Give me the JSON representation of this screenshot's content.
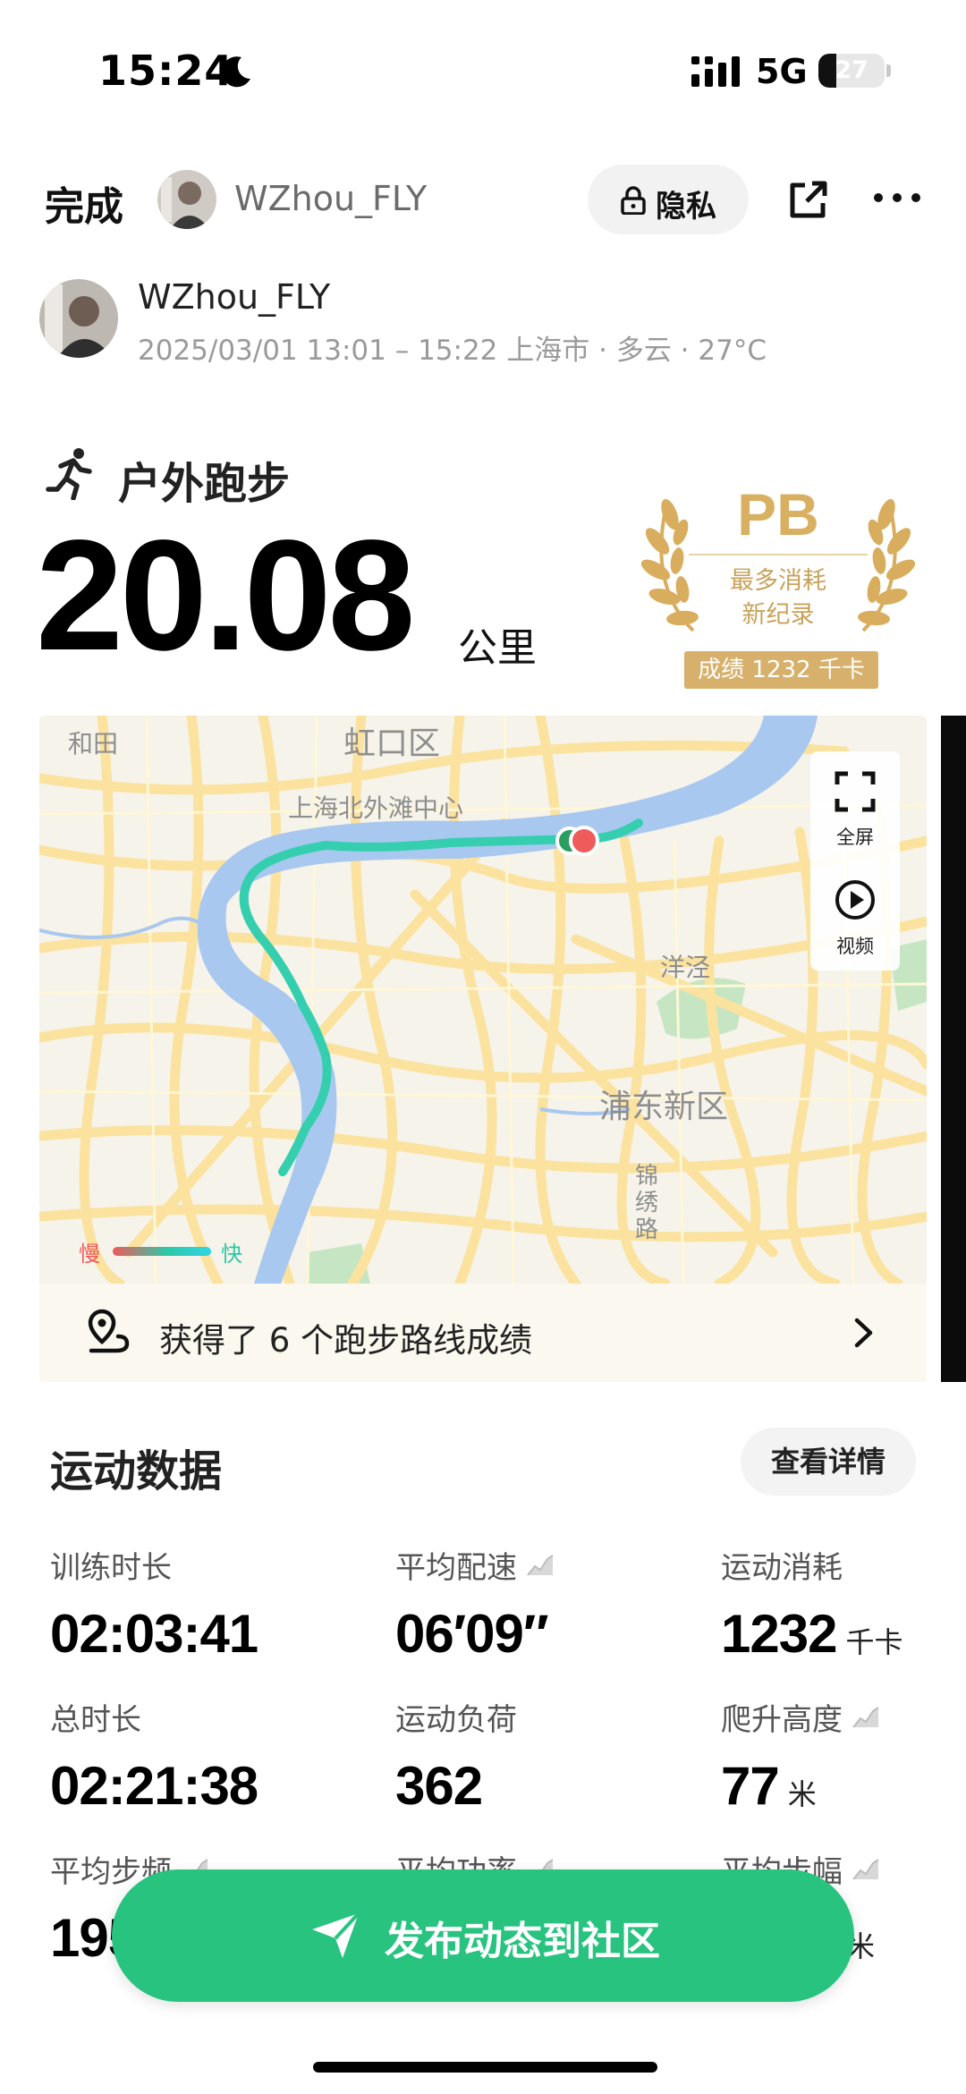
{
  "status_bar": {
    "time": "15:24",
    "network": "5G",
    "battery": "27",
    "battery_level": 0.27
  },
  "nav": {
    "done_label": "完成",
    "username": "WZhou_FLY",
    "privacy_label": "隐私"
  },
  "user": {
    "name": "WZhou_FLY",
    "meta": "2025/03/01 13:01 – 15:22 上海市 · 多云 · 27°C"
  },
  "activity": {
    "type_label": "户外跑步",
    "distance": "20.08",
    "distance_unit": "公里"
  },
  "pb_badge": {
    "title": "PB",
    "line1": "最多消耗",
    "line2": "新纪录",
    "score": "成绩 1232 千卡"
  },
  "map": {
    "labels": [
      "和田",
      "虹口区",
      "上海北外滩中心",
      "洋泾",
      "浦东新区",
      "锦绣路"
    ],
    "fullscreen_label": "全屏",
    "video_label": "视频",
    "legend_slow": "慢",
    "legend_fast": "快",
    "colors": {
      "route": "#35cfb0",
      "water": "#a9c8ef",
      "road": "#fbe29e",
      "park": "#c6e6c3"
    }
  },
  "route_achievement": {
    "text": "获得了 6 个跑步路线成绩"
  },
  "stats": {
    "title": "运动数据",
    "details_label": "查看详情",
    "items": [
      {
        "label": "训练时长",
        "value": "02:03:41",
        "unit": ""
      },
      {
        "label": "平均配速",
        "value": "06′09″",
        "unit": ""
      },
      {
        "label": "运动消耗",
        "value": "1232",
        "unit": "千卡"
      },
      {
        "label": "总时长",
        "value": "02:21:38",
        "unit": ""
      },
      {
        "label": "运动负荷",
        "value": "362",
        "unit": ""
      },
      {
        "label": "爬升高度",
        "value": "77",
        "unit": "米"
      },
      {
        "label": "平均步频",
        "value": "195",
        "unit": ""
      },
      {
        "label": "平均功率",
        "value": "",
        "unit": ""
      },
      {
        "label": "平均步幅",
        "value": "",
        "unit": "米"
      }
    ]
  },
  "publish": {
    "label": "发布动态到社区"
  },
  "theme": {
    "accent": "#27c37f",
    "gold": "#d7b06b"
  }
}
